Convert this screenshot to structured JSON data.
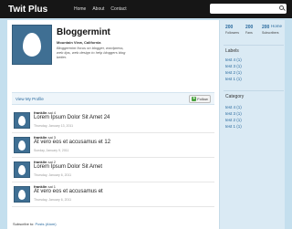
{
  "topbar": {
    "brand": "Twit Plus",
    "nav": [
      "Home",
      "About",
      "Contact"
    ]
  },
  "profile": {
    "name": "Bloggermint",
    "location": "Mountain View, California",
    "bio": "Bloggermint focus on blogger, wordpress, web tips, web design to help bloggers blog better.",
    "view_my_profile": "View My Profile",
    "follow_label": "Follow"
  },
  "tweets": [
    {
      "user": "franklin",
      "meta": "sai 4",
      "text": "Lorem Ipsum Dolor Sit Amet 24",
      "date": "Thursday, January 13, 2011"
    },
    {
      "user": "franklin",
      "meta": "sai 3",
      "text": "At vero eos et accusamus et 12",
      "date": "Sunday, January 9, 2011"
    },
    {
      "user": "franklin",
      "meta": "sai 2",
      "text": "Lorem Ipsum Dolor Sit Amet",
      "date": "Thursday, January 6, 2011"
    },
    {
      "user": "franklin",
      "meta": "sai 1",
      "text": "At vero eos et accusamus et",
      "date": "Thursday, January 6, 2011"
    }
  ],
  "subscribe": {
    "label": "Subscribe to:",
    "link": "Posts (Atom)"
  },
  "sidebar": {
    "stats": [
      {
        "num": "200",
        "label": "Followers"
      },
      {
        "num": "200",
        "label": "Fans"
      },
      {
        "num": "200",
        "label": "Subscribers"
      }
    ],
    "home_link": "Home",
    "labels_title": "Labels",
    "labels": [
      "test 4 (1)",
      "test 3 (1)",
      "test 2 (1)",
      "test 1 (1)"
    ],
    "category_title": "Category",
    "categories": [
      "test 4 (1)",
      "test 3 (1)",
      "test 2 (1)",
      "test 1 (1)"
    ]
  },
  "colors": {
    "topbar": "#161616",
    "page_bg": "#c4dfee",
    "link": "#2a6a9e",
    "avatar": "#3f6f93",
    "follow_green": "#4aa340"
  },
  "icons": [
    "search-icon",
    "egg-avatar-icon",
    "plus-icon"
  ]
}
